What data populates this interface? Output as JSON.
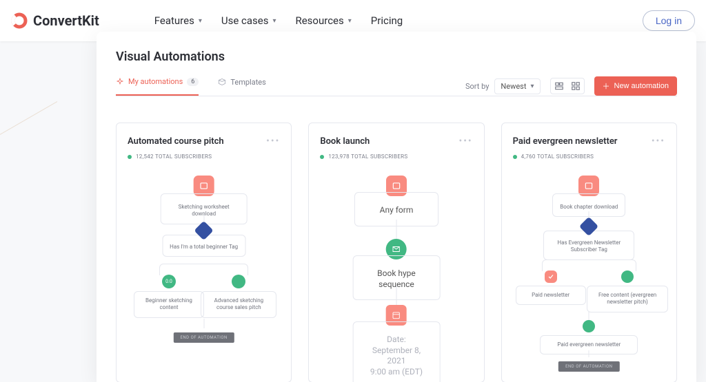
{
  "brand": "ConvertKit",
  "nav": {
    "items": [
      "Features",
      "Use cases",
      "Resources",
      "Pricing"
    ],
    "login": "Log in"
  },
  "page": {
    "title": "Visual Automations",
    "tabs": {
      "my_automations": "My automations",
      "my_automations_count": "6",
      "templates": "Templates"
    },
    "sort_label": "Sort by",
    "sort_value": "Newest",
    "new_button": "New automation"
  },
  "cards": [
    {
      "title": "Automated course pitch",
      "subs": "12,542 TOTAL SUBSCRIBERS",
      "n1": "Sketching worksheet download",
      "n2": "Has I'm a total beginner Tag",
      "left_dot": "0.0",
      "leftbox": "Beginner sketching content",
      "rightbox": "Advanced sketching course sales pitch",
      "end": "END OF AUTOMATION"
    },
    {
      "title": "Book launch",
      "subs": "123,978 TOTAL SUBSCRIBERS",
      "n1": "Any form",
      "n2": "Book hype sequence",
      "n3": "Date: September 8, 2021",
      "n3b": "9:00 am (EDT)"
    },
    {
      "title": "Paid evergreen newsletter",
      "subs": "4,760 TOTAL SUBSCRIBERS",
      "n1": "Book chapter download",
      "n2": "Has Evergreen Newsletter Subscriber Tag",
      "leftbox": "Paid newsletter",
      "rightbox": "Free content (evergreen newsletter pitch)",
      "n3": "Paid evergreen newsletter",
      "end": "END OF AUTOMATION"
    }
  ]
}
